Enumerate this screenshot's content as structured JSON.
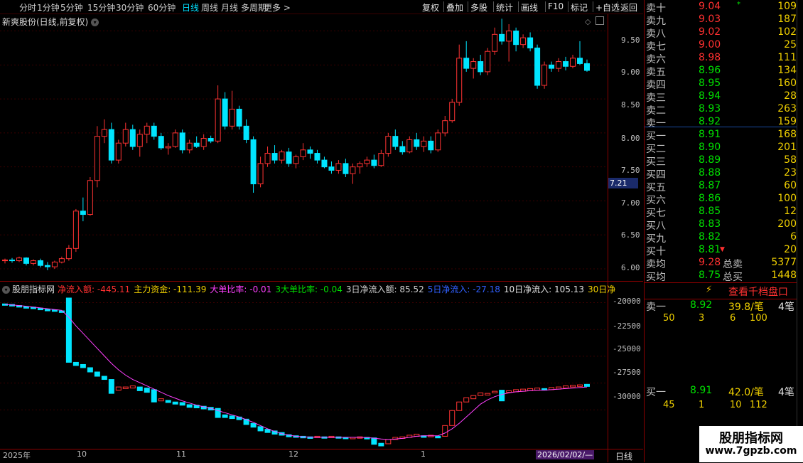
{
  "toolbar": {
    "periods": [
      "分时",
      "1分钟",
      "5分钟",
      "15分钟",
      "30分钟",
      "60分钟",
      "日线",
      "周线",
      "月线",
      "多周期",
      "更多 >"
    ],
    "active_period": "日线",
    "actions": [
      "复权",
      "叠加",
      "多股",
      "统计",
      "画线",
      "F10",
      "标记",
      "+自选",
      "返回"
    ]
  },
  "main": {
    "title": "新爽股份(日线,前复权)",
    "price_ticks": [
      "9.50",
      "9.00",
      "8.50",
      "8.00",
      "7.50",
      "7.00",
      "6.50",
      "6.00"
    ],
    "current_price_tag": "7.21"
  },
  "indicator": {
    "name": "股朋指标网",
    "fields": [
      {
        "text": "净流入额: -445.11",
        "color": "#ff3030"
      },
      {
        "text": "主力资金: -111.39",
        "color": "#f0d000"
      },
      {
        "text": "大单比率: -0.01",
        "color": "#ff40ff"
      },
      {
        "text": "3大单比率: -0.04",
        "color": "#00e000"
      },
      {
        "text": "3日净流入额: 85.52",
        "color": "#d0d0d0"
      },
      {
        "text": "5日净流入: -27.18",
        "color": "#3060ff"
      },
      {
        "text": "10日净流入: 105.13",
        "color": "#e0e0e0"
      },
      {
        "text": "30日净",
        "color": "#f0d000"
      }
    ],
    "ticks": [
      "-20000",
      "-22500",
      "-25000",
      "-27500",
      "-30000"
    ]
  },
  "xaxis": {
    "labels": [
      "2025年",
      "10",
      "11",
      "12",
      "1"
    ],
    "cursor_date": "2026/02/02/—",
    "period": "日线"
  },
  "orderbook": {
    "asks": [
      {
        "label": "卖十",
        "price": "9.04",
        "vol": "109",
        "flag": "*"
      },
      {
        "label": "卖九",
        "price": "9.03",
        "vol": "187"
      },
      {
        "label": "卖八",
        "price": "9.02",
        "vol": "102"
      },
      {
        "label": "卖七",
        "price": "9.00",
        "vol": "25"
      },
      {
        "label": "卖六",
        "price": "8.98",
        "vol": "111"
      },
      {
        "label": "卖五",
        "price": "8.96",
        "vol": "134"
      },
      {
        "label": "卖四",
        "price": "8.95",
        "vol": "160"
      },
      {
        "label": "卖三",
        "price": "8.94",
        "vol": "28"
      },
      {
        "label": "卖二",
        "price": "8.93",
        "vol": "263"
      },
      {
        "label": "卖一",
        "price": "8.92",
        "vol": "159"
      }
    ],
    "bids": [
      {
        "label": "买一",
        "price": "8.91",
        "vol": "168"
      },
      {
        "label": "买二",
        "price": "8.90",
        "vol": "201"
      },
      {
        "label": "买三",
        "price": "8.89",
        "vol": "58"
      },
      {
        "label": "买四",
        "price": "8.88",
        "vol": "23"
      },
      {
        "label": "买五",
        "price": "8.87",
        "vol": "60"
      },
      {
        "label": "买六",
        "price": "8.86",
        "vol": "100"
      },
      {
        "label": "买七",
        "price": "8.85",
        "vol": "12"
      },
      {
        "label": "买八",
        "price": "8.83",
        "vol": "200"
      },
      {
        "label": "买九",
        "price": "8.82",
        "vol": "6"
      },
      {
        "label": "买十",
        "price": "8.81",
        "vol": "20"
      }
    ],
    "avg_sell_label": "卖均",
    "avg_sell": "9.28",
    "total_sell_label": "总卖",
    "total_sell": "5377",
    "avg_buy_label": "买均",
    "avg_buy": "8.75",
    "total_buy_label": "总买",
    "total_buy": "1448",
    "thousand_button": "查看千档盘口",
    "queue_sell": {
      "label": "卖一",
      "price": "8.92",
      "avg": "39.8/笔",
      "count": "4笔",
      "orders": [
        "50",
        "3",
        "6",
        "100"
      ]
    },
    "queue_buy": {
      "label": "买一",
      "price": "8.91",
      "avg": "42.0/笔",
      "count": "4笔",
      "orders": [
        "45",
        "1",
        "10",
        "112"
      ]
    }
  },
  "watermark": {
    "line1": "股朋指标网",
    "line2": "www.7gpzb.com"
  },
  "chart_data": {
    "type": "candlestick",
    "price_range": [
      6.0,
      9.6
    ],
    "candles": [
      [
        6.12,
        6.15,
        6.08,
        6.13
      ],
      [
        6.13,
        6.16,
        6.09,
        6.12
      ],
      [
        6.12,
        6.18,
        6.1,
        6.16
      ],
      [
        6.16,
        6.17,
        6.05,
        6.08
      ],
      [
        6.08,
        6.14,
        6.05,
        6.12
      ],
      [
        6.12,
        6.15,
        6.02,
        6.05
      ],
      [
        6.05,
        6.1,
        5.98,
        6.03
      ],
      [
        6.03,
        6.12,
        6.0,
        6.1
      ],
      [
        6.1,
        6.18,
        6.08,
        6.15
      ],
      [
        6.15,
        6.35,
        6.12,
        6.3
      ],
      [
        6.3,
        6.88,
        6.25,
        6.85
      ],
      [
        6.85,
        7.05,
        6.7,
        6.8
      ],
      [
        6.8,
        7.35,
        6.78,
        7.3
      ],
      [
        7.3,
        8.1,
        7.2,
        7.95
      ],
      [
        7.95,
        8.2,
        7.85,
        8.05
      ],
      [
        8.05,
        8.15,
        7.55,
        7.6
      ],
      [
        7.6,
        7.9,
        7.55,
        7.85
      ],
      [
        7.85,
        8.15,
        7.8,
        8.05
      ],
      [
        8.05,
        8.12,
        7.75,
        7.8
      ],
      [
        7.8,
        8.05,
        7.65,
        7.98
      ],
      [
        7.98,
        8.15,
        7.85,
        8.1
      ],
      [
        8.1,
        8.15,
        7.9,
        7.95
      ],
      [
        7.95,
        8.0,
        7.75,
        7.78
      ],
      [
        7.78,
        7.85,
        7.68,
        7.8
      ],
      [
        7.8,
        8.05,
        7.78,
        8.0
      ],
      [
        8.0,
        8.05,
        7.7,
        7.75
      ],
      [
        7.75,
        7.9,
        7.7,
        7.85
      ],
      [
        7.85,
        7.95,
        7.78,
        7.8
      ],
      [
        7.8,
        7.98,
        7.75,
        7.92
      ],
      [
        7.92,
        7.96,
        7.85,
        7.88
      ],
      [
        7.88,
        8.7,
        7.85,
        8.5
      ],
      [
        8.5,
        8.6,
        8.05,
        8.1
      ],
      [
        8.1,
        8.62,
        8.05,
        8.35
      ],
      [
        8.35,
        8.4,
        8.05,
        8.1
      ],
      [
        8.1,
        8.2,
        7.85,
        7.9
      ],
      [
        7.9,
        7.95,
        7.12,
        7.25
      ],
      [
        7.25,
        7.65,
        7.2,
        7.55
      ],
      [
        7.55,
        7.8,
        7.5,
        7.7
      ],
      [
        7.7,
        7.82,
        7.55,
        7.6
      ],
      [
        7.6,
        7.75,
        7.55,
        7.72
      ],
      [
        7.72,
        7.78,
        7.5,
        7.55
      ],
      [
        7.55,
        7.68,
        7.48,
        7.65
      ],
      [
        7.65,
        7.85,
        7.6,
        7.75
      ],
      [
        7.75,
        7.8,
        7.62,
        7.7
      ],
      [
        7.7,
        7.75,
        7.55,
        7.6
      ],
      [
        7.6,
        7.65,
        7.48,
        7.5
      ],
      [
        7.5,
        7.58,
        7.4,
        7.45
      ],
      [
        7.45,
        7.6,
        7.4,
        7.55
      ],
      [
        7.55,
        7.62,
        7.35,
        7.4
      ],
      [
        7.4,
        7.55,
        7.25,
        7.5
      ],
      [
        7.5,
        7.58,
        7.4,
        7.55
      ],
      [
        7.55,
        7.65,
        7.5,
        7.6
      ],
      [
        7.6,
        7.68,
        7.48,
        7.52
      ],
      [
        7.52,
        7.75,
        7.5,
        7.7
      ],
      [
        7.7,
        8.0,
        7.65,
        7.95
      ],
      [
        7.95,
        8.05,
        7.75,
        7.8
      ],
      [
        7.8,
        7.88,
        7.68,
        7.72
      ],
      [
        7.72,
        7.95,
        7.7,
        7.9
      ],
      [
        7.9,
        8.0,
        7.75,
        7.8
      ],
      [
        7.8,
        7.95,
        7.72,
        7.88
      ],
      [
        7.88,
        7.95,
        7.7,
        7.75
      ],
      [
        7.75,
        8.05,
        7.72,
        8.0
      ],
      [
        8.0,
        8.25,
        7.95,
        8.18
      ],
      [
        8.18,
        8.5,
        8.15,
        8.45
      ],
      [
        8.45,
        9.3,
        8.4,
        9.1
      ],
      [
        9.1,
        9.35,
        8.9,
        8.95
      ],
      [
        8.95,
        9.1,
        8.8,
        9.05
      ],
      [
        9.05,
        9.15,
        8.85,
        8.9
      ],
      [
        8.9,
        9.25,
        8.85,
        9.2
      ],
      [
        9.2,
        9.55,
        9.15,
        9.45
      ],
      [
        9.45,
        9.68,
        9.3,
        9.35
      ],
      [
        9.35,
        9.6,
        9.05,
        9.5
      ],
      [
        9.5,
        9.55,
        9.2,
        9.3
      ],
      [
        9.3,
        9.45,
        9.25,
        9.4
      ],
      [
        9.4,
        9.48,
        9.2,
        9.25
      ],
      [
        9.25,
        9.3,
        8.65,
        8.7
      ],
      [
        8.7,
        9.05,
        8.65,
        9.0
      ],
      [
        9.0,
        9.05,
        8.9,
        8.95
      ],
      [
        8.95,
        9.1,
        8.9,
        9.05
      ],
      [
        9.05,
        9.12,
        8.92,
        8.98
      ],
      [
        8.98,
        9.15,
        8.95,
        9.1
      ],
      [
        9.1,
        9.35,
        9.0,
        9.02
      ],
      [
        9.02,
        9.08,
        8.9,
        8.92
      ]
    ],
    "indicator_range": [
      -31500,
      -19500
    ],
    "indicator_bars": [
      [
        -20050,
        -20150
      ],
      [
        -20100,
        -20250
      ],
      [
        -20200,
        -20350
      ],
      [
        -20300,
        -20450
      ],
      [
        -20350,
        -20500
      ],
      [
        -20450,
        -20600
      ],
      [
        -20550,
        -20700
      ],
      [
        -20600,
        -20750
      ],
      [
        -20700,
        -20850
      ],
      [
        -19500,
        -25500
      ],
      [
        -25500,
        -25800
      ],
      [
        -25700,
        -26000
      ],
      [
        -26000,
        -26400
      ],
      [
        -26400,
        -26800
      ],
      [
        -26800,
        -27100
      ],
      [
        -27100,
        -28400
      ],
      [
        -27800,
        -28100
      ],
      [
        -27800,
        -27950
      ],
      [
        -27700,
        -27900
      ],
      [
        -27800,
        -28150
      ],
      [
        -27900,
        -28300
      ],
      [
        -28050,
        -29200
      ],
      [
        -28900,
        -29100
      ],
      [
        -29050,
        -29250
      ],
      [
        -29200,
        -29400
      ],
      [
        -29250,
        -29500
      ],
      [
        -29450,
        -29700
      ],
      [
        -29500,
        -29750
      ],
      [
        -29600,
        -29850
      ],
      [
        -29700,
        -29950
      ],
      [
        -29800,
        -30650
      ],
      [
        -30400,
        -30650
      ],
      [
        -30500,
        -30750
      ],
      [
        -30600,
        -30850
      ],
      [
        -30800,
        -31300
      ],
      [
        -31200,
        -31550
      ],
      [
        -31500,
        -31900
      ],
      [
        -31750,
        -32050
      ],
      [
        -31900,
        -32200
      ],
      [
        -32050,
        -32300
      ],
      [
        -32250,
        -32450
      ],
      [
        -32350,
        -32500
      ],
      [
        -32400,
        -32550
      ],
      [
        -32450,
        -32600
      ],
      [
        -32400,
        -32500
      ],
      [
        -32450,
        -32550
      ],
      [
        -32400,
        -32520
      ],
      [
        -32450,
        -32560
      ],
      [
        -32500,
        -32620
      ],
      [
        -32500,
        -32600
      ],
      [
        -32450,
        -32550
      ],
      [
        -32500,
        -32650
      ],
      [
        -32550,
        -33150
      ],
      [
        -33050,
        -33300
      ],
      [
        -32700,
        -33100
      ],
      [
        -32500,
        -32700
      ],
      [
        -32450,
        -32600
      ],
      [
        -32300,
        -32500
      ],
      [
        -32200,
        -32400
      ],
      [
        -32350,
        -32500
      ],
      [
        -32300,
        -32450
      ],
      [
        -32400,
        -32550
      ],
      [
        -31400,
        -32400
      ],
      [
        -30000,
        -31400
      ],
      [
        -29200,
        -30000
      ],
      [
        -28800,
        -29200
      ],
      [
        -28600,
        -28900
      ],
      [
        -28350,
        -28600
      ],
      [
        -28400,
        -28550
      ],
      [
        -28200,
        -28350
      ],
      [
        -28100,
        -29100
      ],
      [
        -28150,
        -28300
      ],
      [
        -28050,
        -28250
      ],
      [
        -28000,
        -28200
      ],
      [
        -27950,
        -28150
      ],
      [
        -27900,
        -28100
      ],
      [
        -27950,
        -28100
      ],
      [
        -27850,
        -28050
      ],
      [
        -27800,
        -28000
      ],
      [
        -27700,
        -27900
      ],
      [
        -27650,
        -27800
      ],
      [
        -27600,
        -27750
      ],
      [
        -27550,
        -27750
      ]
    ],
    "indicator_ma": [
      -20100,
      -20150,
      -20200,
      -20270,
      -20350,
      -20420,
      -20500,
      -20580,
      -20650,
      -21300,
      -22100,
      -22800,
      -23500,
      -24200,
      -24900,
      -25600,
      -26200,
      -26700,
      -27100,
      -27400,
      -27700,
      -28000,
      -28300,
      -28600,
      -28850,
      -29100,
      -29300,
      -29500,
      -29650,
      -29800,
      -30000,
      -30200,
      -30400,
      -30600,
      -30850,
      -31100,
      -31400,
      -31700,
      -31950,
      -32150,
      -32300,
      -32400,
      -32450,
      -32480,
      -32500,
      -32500,
      -32500,
      -32500,
      -32500,
      -32500,
      -32500,
      -32520,
      -32580,
      -32650,
      -32700,
      -32650,
      -32600,
      -32500,
      -32400,
      -32350,
      -32350,
      -32350,
      -32100,
      -31700,
      -31200,
      -30600,
      -30000,
      -29400,
      -29000,
      -28700,
      -28500,
      -28350,
      -28250,
      -28200,
      -28150,
      -28100,
      -28100,
      -28050,
      -28000,
      -27950,
      -27900,
      -27850,
      -27800
    ]
  }
}
